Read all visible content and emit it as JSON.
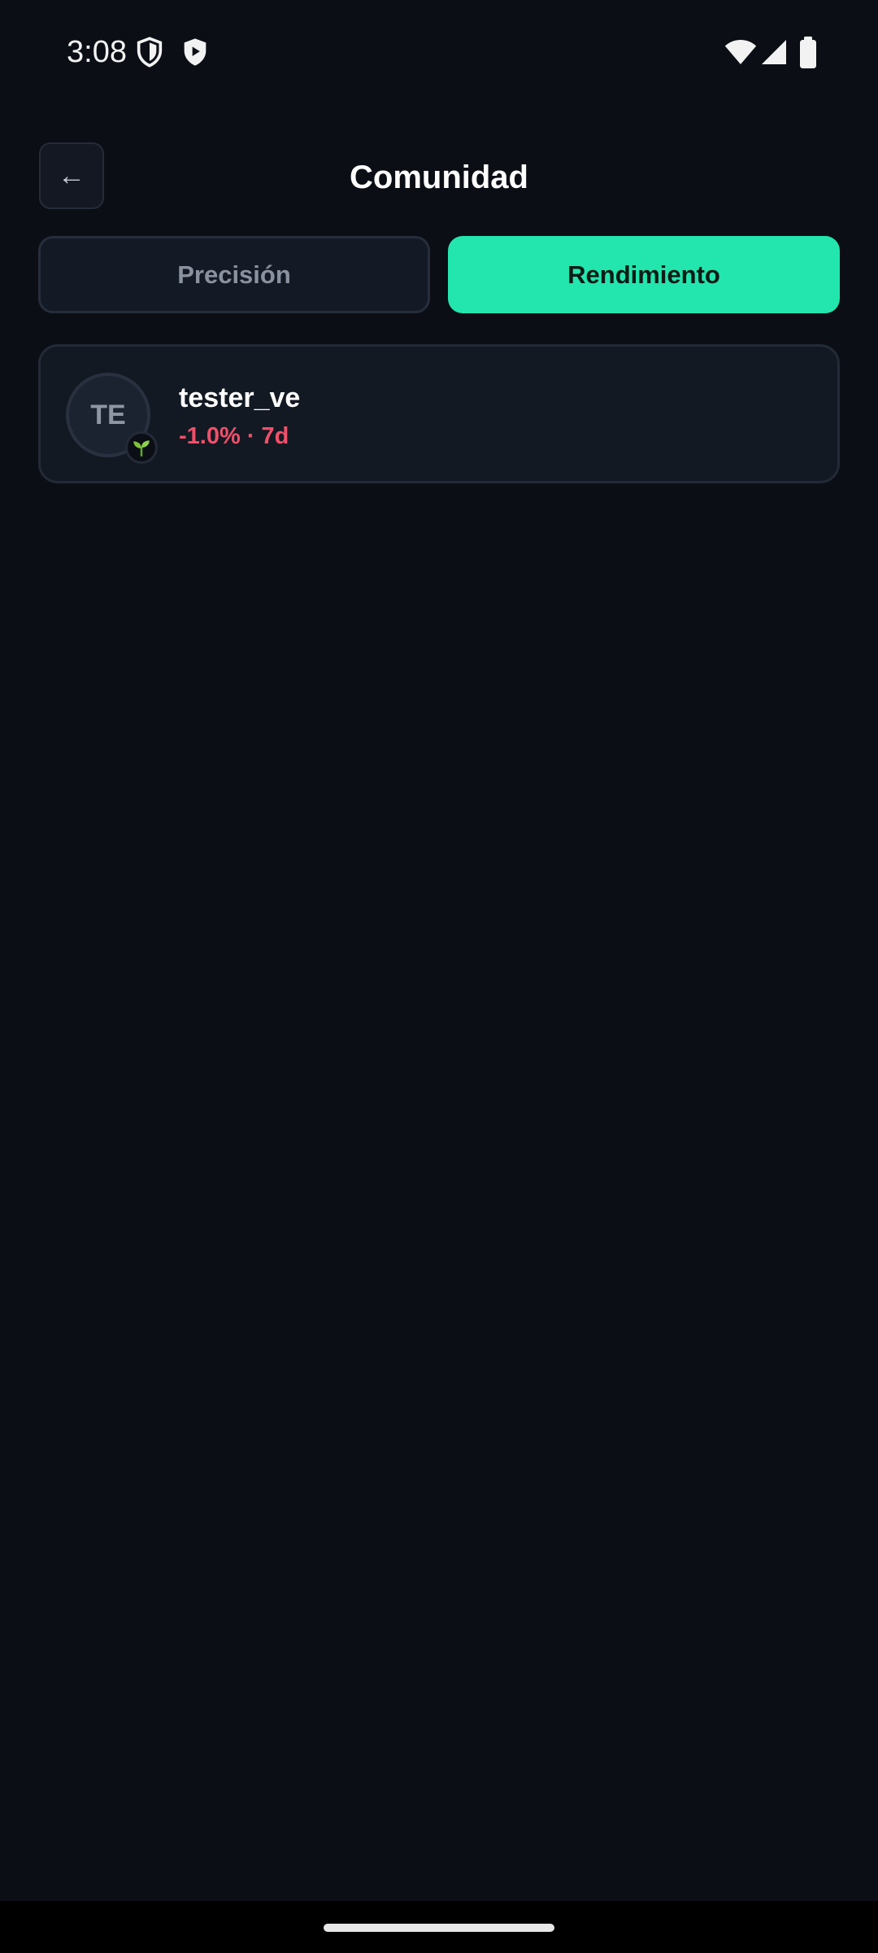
{
  "status_bar": {
    "time": "3:08",
    "left_icons": [
      "shield-outline-icon",
      "play-shield-icon"
    ],
    "right_icons": [
      "wifi-icon",
      "signal-icon",
      "battery-icon"
    ]
  },
  "header": {
    "title": "Comunidad",
    "back_icon": "←"
  },
  "tabs": [
    {
      "label": "Precisión",
      "active": false
    },
    {
      "label": "Rendimiento",
      "active": true
    }
  ],
  "users": [
    {
      "initials": "TE",
      "name": "tester_ve",
      "stats": "-1.0% · 7d",
      "badge_icon": "sprout-icon"
    }
  ],
  "colors": {
    "background": "#0b0e15",
    "accent": "#22e6ad",
    "negative": "#f0506a",
    "card": "#131923"
  }
}
